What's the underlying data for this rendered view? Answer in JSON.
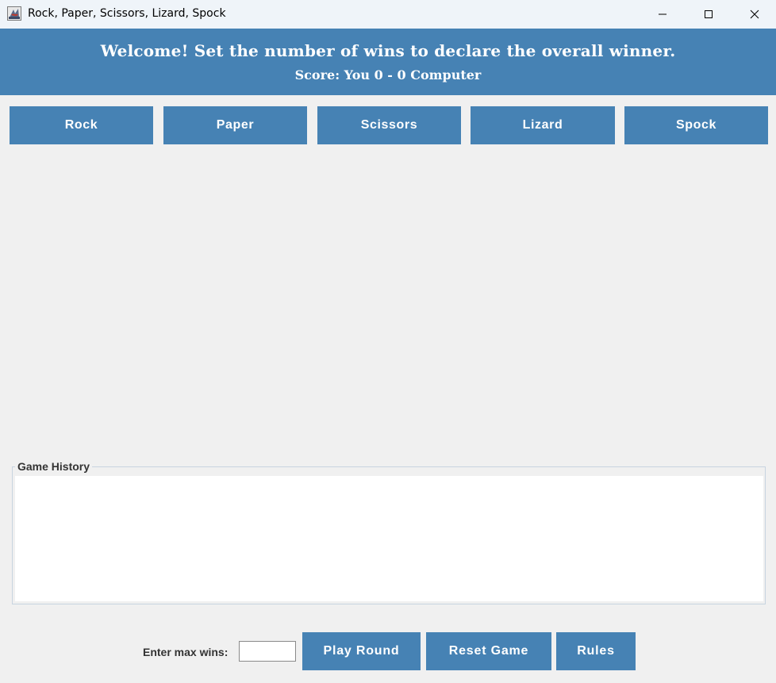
{
  "window": {
    "title": "Rock, Paper, Scissors, Lizard, Spock",
    "icons": {
      "app": "java-app-icon",
      "minimize": "minimize-icon",
      "maximize": "maximize-icon",
      "close": "close-icon"
    }
  },
  "header": {
    "welcome": "Welcome! Set the number of wins to declare the overall winner.",
    "score": "Score: You 0 - 0 Computer"
  },
  "choices": [
    {
      "label": "Rock"
    },
    {
      "label": "Paper"
    },
    {
      "label": "Scissors"
    },
    {
      "label": "Lizard"
    },
    {
      "label": "Spock"
    }
  ],
  "history": {
    "title": "Game History",
    "content": ""
  },
  "controls": {
    "max_wins_label": "Enter max wins:",
    "max_wins_value": "",
    "play_label": "Play Round",
    "reset_label": "Reset Game",
    "rules_label": "Rules"
  },
  "colors": {
    "accent": "#4682b4",
    "background": "#f0f0f0",
    "titlebar": "#eff4f9"
  }
}
